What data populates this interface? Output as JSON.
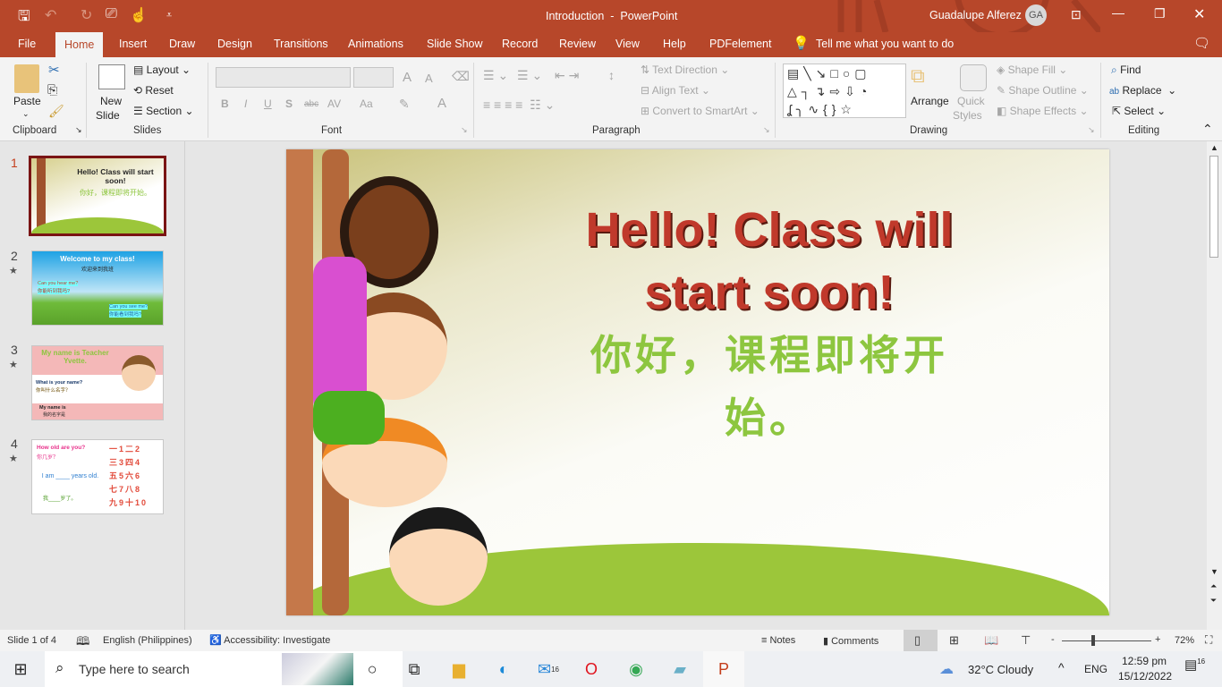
{
  "titlebar": {
    "doc_title": "Introduction",
    "separator": "-",
    "app": "PowerPoint",
    "user": "Guadalupe Alferez",
    "initials": "GA"
  },
  "tabs": [
    "File",
    "Home",
    "Insert",
    "Draw",
    "Design",
    "Transitions",
    "Animations",
    "Slide Show",
    "Record",
    "Review",
    "View",
    "Help",
    "PDFelement"
  ],
  "tell_me": "Tell me what you want to do",
  "ribbon": {
    "clipboard": {
      "paste": "Paste",
      "group": "Clipboard"
    },
    "slides": {
      "new_slide": "New",
      "new_slide2": "Slide",
      "layout": "Layout",
      "reset": "Reset",
      "section": "Section",
      "group": "Slides"
    },
    "font": {
      "bold": "B",
      "italic": "I",
      "underline": "U",
      "shadow": "S",
      "strike": "abc",
      "spacing": "AV",
      "case": "Aa",
      "color": "A",
      "grow": "A",
      "shrink": "A",
      "group": "Font"
    },
    "paragraph": {
      "text_direction": "Text Direction",
      "align_text": "Align Text",
      "smartart": "Convert to SmartArt",
      "group": "Paragraph"
    },
    "drawing": {
      "arrange": "Arrange",
      "quick": "Quick",
      "styles": "Styles",
      "shape_fill": "Shape Fill",
      "shape_outline": "Shape Outline",
      "shape_effects": "Shape Effects",
      "group": "Drawing"
    },
    "editing": {
      "find": "Find",
      "replace": "Replace",
      "select": "Select",
      "group": "Editing"
    }
  },
  "thumbnails": [
    {
      "num": "1",
      "title": "Hello! Class will start soon!",
      "sub": "你好，课程即将开始。"
    },
    {
      "num": "2",
      "title": "Welcome to my class!",
      "sub": "欢迎来到我班",
      "q1": "Can you hear me?",
      "q1zh": "你能听到我吗?",
      "q2": "Can you see me?",
      "q2zh": "你能看到我吗?"
    },
    {
      "num": "3",
      "title": "My name is Teacher Yvette.",
      "q1": "What is your name?",
      "q1zh": "你叫什么名字？",
      "q2": "My name is",
      "q2zh": "我的名字是"
    },
    {
      "num": "4",
      "title": "How old are you?",
      "sub": "你几岁？",
      "body": "I am ____ years old.",
      "bodyzh": "我____岁了。"
    }
  ],
  "slide": {
    "title": "Hello! Class will start soon!",
    "subtitle": "你好，课程即将开始。",
    "title_color": "#c0392b",
    "subtitle_color": "#8dc63f"
  },
  "status": {
    "slide": "Slide 1 of 4",
    "language": "English (Philippines)",
    "accessibility": "Accessibility: Investigate",
    "notes": "Notes",
    "comments": "Comments",
    "zoom": "72%",
    "minus": "-",
    "plus": "+"
  },
  "taskbar": {
    "search": "Type here to search",
    "weather": "32°C  Cloudy",
    "lang": "ENG",
    "time": "12:59 pm",
    "date": "15/12/2022",
    "mail_badge": "16",
    "notif_badge": "16"
  }
}
